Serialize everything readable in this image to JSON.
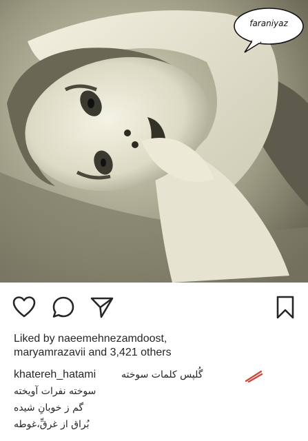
{
  "photo": {
    "watermark": "faraniyaz"
  },
  "actions": {
    "like_icon": "heart-icon",
    "comment_icon": "comment-icon",
    "share_icon": "share-icon",
    "save_icon": "bookmark-icon"
  },
  "likes": {
    "prefix": "Liked by",
    "user1": "naeemehnezamdoost,",
    "user2": "maryamrazavii",
    "connector": "and",
    "count": "3,421 others"
  },
  "caption": {
    "username": "khatereh_hatami",
    "lines": [
      "گُلپس کلمات سوخته",
      "سوخته نفرات آویخته",
      "گم ز خوبانِ شیده",
      "بُراق از غرقِّ،غوطه"
    ]
  },
  "colors": {
    "text": "#262626",
    "background": "#ffffff"
  }
}
